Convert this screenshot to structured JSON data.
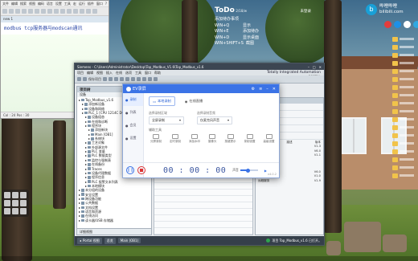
{
  "notepad": {
    "menu": [
      "文件",
      "编辑",
      "搜索",
      "视图",
      "编码",
      "语言",
      "设置",
      "工具",
      "宏",
      "运行",
      "插件",
      "窗口",
      "?"
    ],
    "tab": "new 1",
    "text": "modbus tcp服务器与modscan通讯",
    "status_left": "Col : 24   Pos : 30",
    "status_right": "Windows (CR LF)"
  },
  "todo": {
    "title": "ToDo",
    "date": "2/18/w",
    "login": "未登录",
    "items": [
      {
        "key": "添加待办事项",
        "val": ""
      },
      {
        "key": "WIN+Q",
        "val": "显示"
      },
      {
        "key": "WIN+E",
        "val": "添加待办"
      },
      {
        "key": "WIN+D",
        "val": "显示桌面"
      },
      {
        "key": "WIN+SHIFT+S",
        "val": "截图"
      }
    ]
  },
  "bili": {
    "logo": "b",
    "line1": "哔哩哔哩",
    "line2": "bilibili.com"
  },
  "tia": {
    "title": "Siemens - C:\\Users\\Administrator\\Desktop\\Top_Modbus_V1.6\\Top_Modbus_v1.6",
    "menu": [
      "项目",
      "编辑",
      "视图",
      "插入",
      "在线",
      "选项",
      "工具",
      "窗口",
      "帮助"
    ],
    "brand_line1": "Totally Integrated Automation",
    "brand_line2": "PORTAL",
    "toolbar_label": "保存项目",
    "tree": {
      "header": "项目树",
      "sub": "设备",
      "items": [
        "Top_Modbus_v1.6",
        "添加新设备",
        "设备和网络",
        "PLC_1 [CPU 1214C DC/DC/DC]",
        "设备组态",
        "在线和诊断",
        "程序块",
        "添加新块",
        "Main [OB1]",
        "系统块",
        "工艺对象",
        "外部源文件",
        "PLC 变量",
        "PLC 数据类型",
        "监控与强制表",
        "在线备份",
        "Traces",
        "设备代理数据",
        "程序信息",
        "PLC 报警文本列表",
        "本地模块",
        "未分组的设备",
        "安全设置",
        "跨设备功能",
        "公共数据",
        "文档设置",
        "语言和资源",
        "在线访问",
        "读卡器/USB 存储器"
      ],
      "detail": "详细视图"
    },
    "right_panel": {
      "title": "选项",
      "sections": [
        "收藏夹",
        "基本指令",
        "扩展指令",
        "工艺",
        "通信"
      ],
      "table_head": [
        "名称",
        "描述",
        "版本"
      ],
      "rows": [
        [
          "S7 通信",
          "",
          "V1.3"
        ],
        [
          "开放式用户通信",
          "",
          "V6.0"
        ],
        [
          "WEB 服务器",
          "",
          "V1.1"
        ],
        [
          "其它",
          "",
          ""
        ],
        [
          "通信处理器",
          "",
          ""
        ],
        [
          "PROFIBUS",
          "",
          ""
        ],
        [
          "MODBUS TCP",
          "",
          "V6.0"
        ],
        [
          "通讯 PROFI...",
          "",
          "V1.0"
        ],
        [
          "远程服务",
          "",
          "V1.9"
        ]
      ]
    },
    "status": {
      "portal": "Portal 视图",
      "overview": "总览",
      "main": "Main (OB1)",
      "msg": "项目 Top_Modbus_v1.6 已打开。"
    }
  },
  "ev": {
    "title": "EV录屏",
    "side": [
      {
        "label": "录制",
        "on": true
      },
      {
        "label": "列表",
        "on": false
      },
      {
        "label": "会员",
        "on": false
      },
      {
        "label": "设置",
        "on": false
      }
    ],
    "tabs": [
      {
        "label": "本地录制",
        "on": true
      },
      {
        "label": "在线直播",
        "on": false
      }
    ],
    "record_area": {
      "label": "选择录制区域",
      "value": "全屏录制"
    },
    "record_audio": {
      "label": "选择录制音频",
      "value": "仅麦克风声音"
    },
    "tools_head": "辅助工具",
    "tools": [
      "分屏录制",
      "定时录制",
      "添加水印",
      "摄像头",
      "按键提示",
      "录制设置",
      "高级设置"
    ],
    "time": "00 : 00 : 00",
    "volume_label": "声音",
    "volume": 0.45,
    "version": "v4.0.2"
  }
}
